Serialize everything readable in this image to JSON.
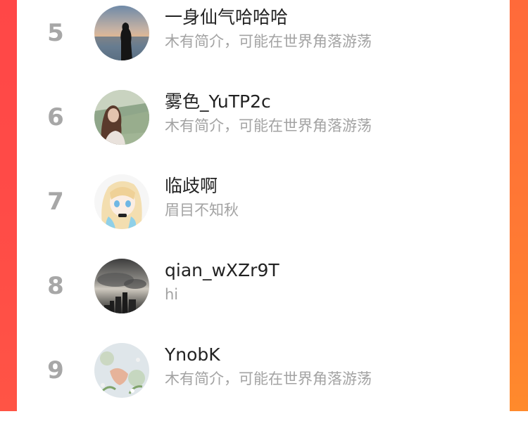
{
  "rank_list": {
    "items": [
      {
        "rank": "5",
        "name": "一身仙气哈哈哈",
        "bio": "木有简介，可能在世界角落游荡",
        "avatar": "sunset-silhouette-avatar"
      },
      {
        "rank": "6",
        "name": "雾色_YuTP2c",
        "bio": "木有简介，可能在世界角落游荡",
        "avatar": "girl-photo-avatar"
      },
      {
        "rank": "7",
        "name": "临歧啊",
        "bio": "眉目不知秋",
        "avatar": "anime-girl-avatar"
      },
      {
        "rank": "8",
        "name": "qian_wXZr9T",
        "bio": "hi",
        "avatar": "city-clouds-avatar"
      },
      {
        "rank": "9",
        "name": "YnobK",
        "bio": "木有简介，可能在世界角落游荡",
        "avatar": "flowers-hand-avatar"
      }
    ]
  },
  "colors": {
    "rank_gray": "#a7a7a7",
    "name_dark": "#222222",
    "bio_gray": "#a3a3a3",
    "left_bg_red": "#ff4747",
    "right_bg_orange": "#ff7a33"
  }
}
